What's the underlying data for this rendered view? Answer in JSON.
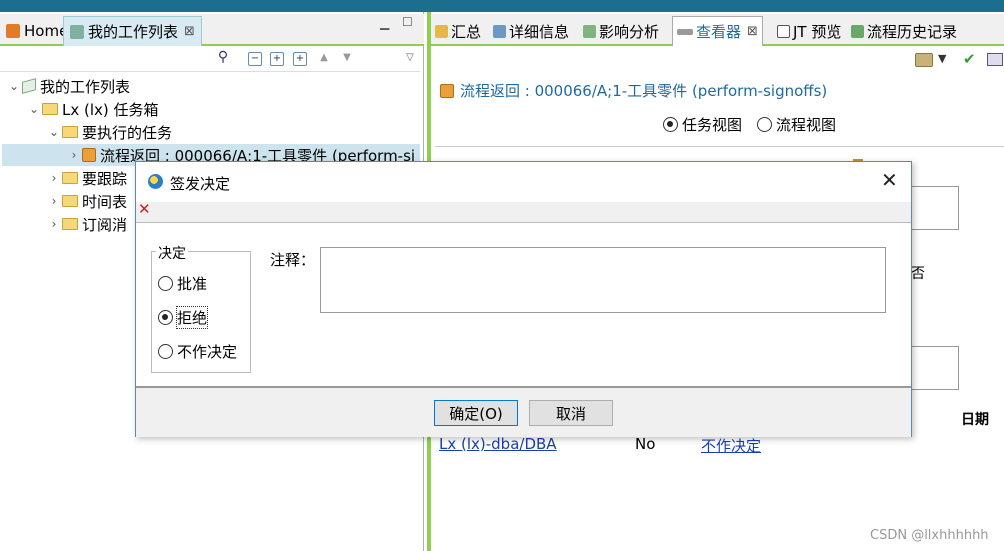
{
  "left": {
    "tabs": [
      {
        "label": "Home"
      },
      {
        "label": "我的工作列表"
      }
    ],
    "tree": {
      "root": "我的工作列表",
      "inbox": "Lx (lx) 任务箱",
      "todo": "要执行的任务",
      "task": "流程返回 : 000066/A;1-工具零件 (perform-si",
      "track": "要跟踪",
      "schedule": "时间表",
      "subscriptions": "订阅消"
    }
  },
  "right": {
    "tabs": [
      {
        "label": "汇总"
      },
      {
        "label": "详细信息"
      },
      {
        "label": "影响分析"
      },
      {
        "label": "查看器"
      },
      {
        "label": "JT 预览"
      },
      {
        "label": "流程历史记录"
      }
    ],
    "process_title": "流程返回 : 000066/A;1-工具零件 (perform-signoffs)",
    "view_options": {
      "task": "任务视图",
      "process": "流程视图",
      "selected": "任务视图"
    },
    "partial_text": "否",
    "table_header_date": "日期",
    "bottom_row": {
      "user": "Lx (lx)-dba/DBA",
      "status": "No",
      "decision": "不作决定"
    }
  },
  "dialog": {
    "title": "签发决定",
    "group_label": "决定",
    "options": [
      {
        "label": "批准",
        "checked": false
      },
      {
        "label": "拒绝",
        "checked": true
      },
      {
        "label": "不作决定",
        "checked": false
      }
    ],
    "note_label": "注释：",
    "note_value": "",
    "ok_label": "确定(O)",
    "cancel_label": "取消"
  },
  "watermark": "CSDN @llxhhhhhh",
  "colors": {
    "accent_green": "#8fcf50",
    "link_blue": "#1a3fb0",
    "title_blue": "#1e6aa0"
  }
}
